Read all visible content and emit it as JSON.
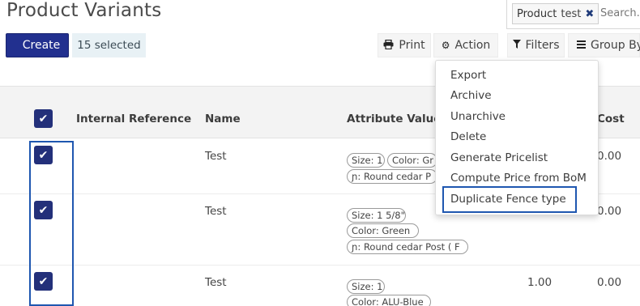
{
  "page": {
    "title": "Product Variants"
  },
  "search": {
    "facet_key": "Product",
    "facet_value": "test",
    "facet_remove": "✖",
    "placeholder": "Search..."
  },
  "toolbar": {
    "create_label": "Create",
    "selected_label": "15 selected",
    "print_label": "Print",
    "action_label": "Action",
    "filters_label": "Filters",
    "groupby_label": "Group By"
  },
  "icons": {
    "print": "printer-icon",
    "action": "gear-icon",
    "filters": "funnel-icon",
    "groupby": "list-icon",
    "check": "check-icon"
  },
  "table": {
    "columns": [
      "Internal Reference",
      "Name",
      "Attribute Values",
      "Cost"
    ],
    "rows": [
      {
        "name": "Test",
        "attributes": [
          "Size: 1",
          "Color: Gr",
          "ɲ: Round cedar P"
        ],
        "price": "",
        "cost": "0.00"
      },
      {
        "name": "Test",
        "attributes": [
          "Size: 1 5/8\"",
          "Color: Green",
          "ɲ: Round cedar Post ( F"
        ],
        "price": "",
        "cost": "0.00"
      },
      {
        "name": "Test",
        "attributes": [
          "Size: 1",
          "Color: ALU-Blue"
        ],
        "price": "1.00",
        "cost": "0.00"
      }
    ]
  },
  "action_menu": {
    "items": [
      "Export",
      "Archive",
      "Unarchive",
      "Delete",
      "Generate Pricelist",
      "Compute Price from BoM",
      "Duplicate Fence type"
    ]
  },
  "colors": {
    "primary": "#22308f",
    "checkbox": "#23307a",
    "highlight_border": "#1f57b0",
    "selected_badge_bg": "#e8f1f5"
  }
}
